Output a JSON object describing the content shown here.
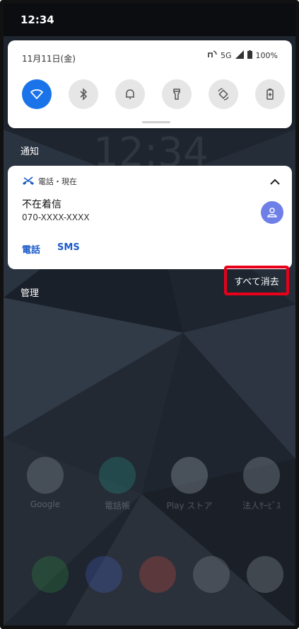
{
  "status_bar": {
    "time": "12:34"
  },
  "quick_settings": {
    "date": "11月11日(金)",
    "network": "5G",
    "battery": "100%",
    "tiles": [
      {
        "name": "wifi-icon",
        "active": true
      },
      {
        "name": "bluetooth-icon",
        "active": false
      },
      {
        "name": "bell-icon",
        "active": false
      },
      {
        "name": "flashlight-icon",
        "active": false
      },
      {
        "name": "auto-rotate-icon",
        "active": false
      },
      {
        "name": "battery-saver-icon",
        "active": false
      }
    ]
  },
  "notifications_header": "通知",
  "notification": {
    "app_label": "電話・現在",
    "title": "不在着信",
    "number": "070-XXXX-XXXX",
    "actions": [
      "電話",
      "SMS"
    ]
  },
  "manage_label": "管理",
  "clear_all_label": "すべて消去",
  "home_apps": [
    {
      "label": "Google",
      "icon": "google-folder-icon"
    },
    {
      "label": "電話帳",
      "icon": "contacts-icon"
    },
    {
      "label": "Play ストア",
      "icon": "play-store-icon"
    },
    {
      "label": "法人ｻｰﾋﾞｽ",
      "icon": "business-services-icon"
    }
  ],
  "dock_apps": [
    "phone-icon",
    "messages-icon",
    "chrome-icon",
    "camera-icon",
    "settings-icon"
  ],
  "colors": {
    "accent": "#1a73e8",
    "highlight": "#e8001b",
    "notification_avatar": "#6f7fe8"
  }
}
